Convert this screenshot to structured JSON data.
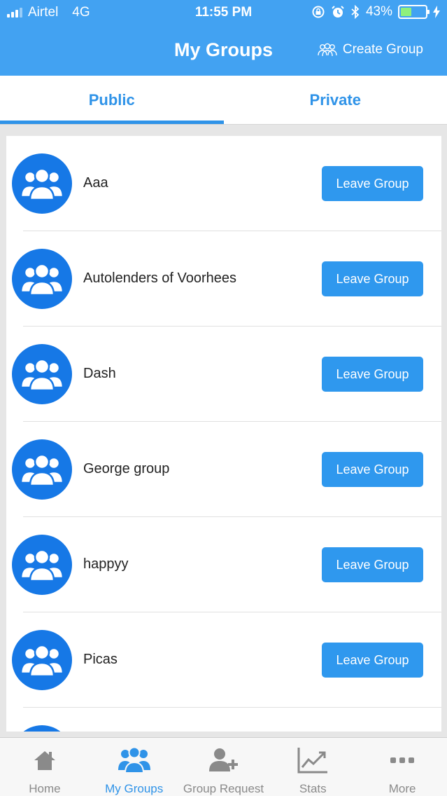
{
  "status_bar": {
    "carrier": "Airtel",
    "network": "4G",
    "time": "11:55 PM",
    "battery_percent_label": "43%",
    "battery_level": 0.43
  },
  "header": {
    "title": "My Groups",
    "create_group_label": "Create Group"
  },
  "tabs": [
    {
      "label": "Public",
      "active": true
    },
    {
      "label": "Private",
      "active": false
    }
  ],
  "groups": [
    {
      "name": "Aaa",
      "action_label": "Leave Group"
    },
    {
      "name": "Autolenders of Voorhees",
      "action_label": "Leave Group"
    },
    {
      "name": "Dash",
      "action_label": "Leave Group"
    },
    {
      "name": "George group",
      "action_label": "Leave Group"
    },
    {
      "name": "happyy",
      "action_label": "Leave Group"
    },
    {
      "name": "Picas",
      "action_label": "Leave Group"
    }
  ],
  "tab_bar": [
    {
      "label": "Home",
      "icon": "home-icon",
      "active": false
    },
    {
      "label": "My Groups",
      "icon": "groups-icon",
      "active": true
    },
    {
      "label": "Group Request",
      "icon": "add-user-icon",
      "active": false
    },
    {
      "label": "Stats",
      "icon": "stats-icon",
      "active": false
    },
    {
      "label": "More",
      "icon": "more-icon",
      "active": false
    }
  ],
  "colors": {
    "header_bg": "#42a2f2",
    "accent": "#2f93e8",
    "avatar_bg": "#1678e6",
    "button_bg": "#2f98ee",
    "battery_fill": "#8ff07c"
  }
}
